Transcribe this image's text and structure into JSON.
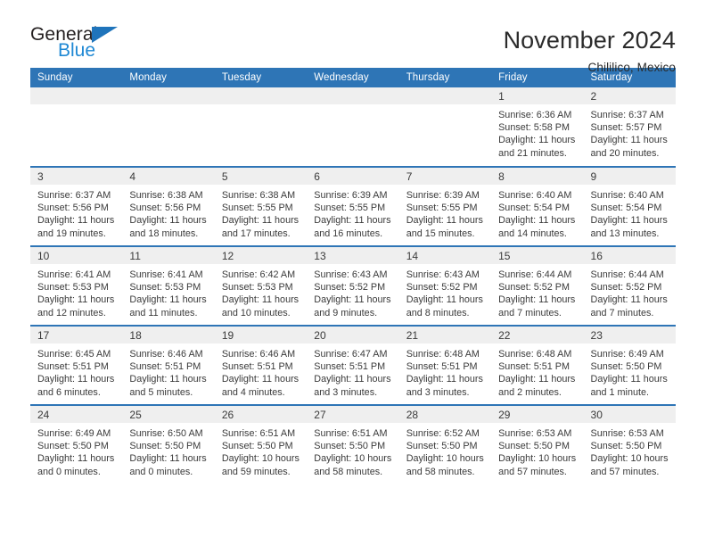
{
  "brand": {
    "name_top": "General",
    "name_bottom": "Blue",
    "triangle_color": "#1f74bb",
    "blue_text_color": "#1f88d4"
  },
  "header": {
    "title": "November 2024",
    "subtitle": "Chililico, Mexico"
  },
  "theme": {
    "header_blue": "#2e75b6",
    "daynum_band": "#efefef",
    "text": "#3a3a3a"
  },
  "weekday_headers": [
    "Sunday",
    "Monday",
    "Tuesday",
    "Wednesday",
    "Thursday",
    "Friday",
    "Saturday"
  ],
  "weeks": [
    [
      {
        "day": "",
        "empty": true
      },
      {
        "day": "",
        "empty": true
      },
      {
        "day": "",
        "empty": true
      },
      {
        "day": "",
        "empty": true
      },
      {
        "day": "",
        "empty": true
      },
      {
        "day": "1",
        "sunrise": "Sunrise: 6:36 AM",
        "sunset": "Sunset: 5:58 PM",
        "daylight1": "Daylight: 11 hours",
        "daylight2": "and 21 minutes."
      },
      {
        "day": "2",
        "sunrise": "Sunrise: 6:37 AM",
        "sunset": "Sunset: 5:57 PM",
        "daylight1": "Daylight: 11 hours",
        "daylight2": "and 20 minutes."
      }
    ],
    [
      {
        "day": "3",
        "sunrise": "Sunrise: 6:37 AM",
        "sunset": "Sunset: 5:56 PM",
        "daylight1": "Daylight: 11 hours",
        "daylight2": "and 19 minutes."
      },
      {
        "day": "4",
        "sunrise": "Sunrise: 6:38 AM",
        "sunset": "Sunset: 5:56 PM",
        "daylight1": "Daylight: 11 hours",
        "daylight2": "and 18 minutes."
      },
      {
        "day": "5",
        "sunrise": "Sunrise: 6:38 AM",
        "sunset": "Sunset: 5:55 PM",
        "daylight1": "Daylight: 11 hours",
        "daylight2": "and 17 minutes."
      },
      {
        "day": "6",
        "sunrise": "Sunrise: 6:39 AM",
        "sunset": "Sunset: 5:55 PM",
        "daylight1": "Daylight: 11 hours",
        "daylight2": "and 16 minutes."
      },
      {
        "day": "7",
        "sunrise": "Sunrise: 6:39 AM",
        "sunset": "Sunset: 5:55 PM",
        "daylight1": "Daylight: 11 hours",
        "daylight2": "and 15 minutes."
      },
      {
        "day": "8",
        "sunrise": "Sunrise: 6:40 AM",
        "sunset": "Sunset: 5:54 PM",
        "daylight1": "Daylight: 11 hours",
        "daylight2": "and 14 minutes."
      },
      {
        "day": "9",
        "sunrise": "Sunrise: 6:40 AM",
        "sunset": "Sunset: 5:54 PM",
        "daylight1": "Daylight: 11 hours",
        "daylight2": "and 13 minutes."
      }
    ],
    [
      {
        "day": "10",
        "sunrise": "Sunrise: 6:41 AM",
        "sunset": "Sunset: 5:53 PM",
        "daylight1": "Daylight: 11 hours",
        "daylight2": "and 12 minutes."
      },
      {
        "day": "11",
        "sunrise": "Sunrise: 6:41 AM",
        "sunset": "Sunset: 5:53 PM",
        "daylight1": "Daylight: 11 hours",
        "daylight2": "and 11 minutes."
      },
      {
        "day": "12",
        "sunrise": "Sunrise: 6:42 AM",
        "sunset": "Sunset: 5:53 PM",
        "daylight1": "Daylight: 11 hours",
        "daylight2": "and 10 minutes."
      },
      {
        "day": "13",
        "sunrise": "Sunrise: 6:43 AM",
        "sunset": "Sunset: 5:52 PM",
        "daylight1": "Daylight: 11 hours",
        "daylight2": "and 9 minutes."
      },
      {
        "day": "14",
        "sunrise": "Sunrise: 6:43 AM",
        "sunset": "Sunset: 5:52 PM",
        "daylight1": "Daylight: 11 hours",
        "daylight2": "and 8 minutes."
      },
      {
        "day": "15",
        "sunrise": "Sunrise: 6:44 AM",
        "sunset": "Sunset: 5:52 PM",
        "daylight1": "Daylight: 11 hours",
        "daylight2": "and 7 minutes."
      },
      {
        "day": "16",
        "sunrise": "Sunrise: 6:44 AM",
        "sunset": "Sunset: 5:52 PM",
        "daylight1": "Daylight: 11 hours",
        "daylight2": "and 7 minutes."
      }
    ],
    [
      {
        "day": "17",
        "sunrise": "Sunrise: 6:45 AM",
        "sunset": "Sunset: 5:51 PM",
        "daylight1": "Daylight: 11 hours",
        "daylight2": "and 6 minutes."
      },
      {
        "day": "18",
        "sunrise": "Sunrise: 6:46 AM",
        "sunset": "Sunset: 5:51 PM",
        "daylight1": "Daylight: 11 hours",
        "daylight2": "and 5 minutes."
      },
      {
        "day": "19",
        "sunrise": "Sunrise: 6:46 AM",
        "sunset": "Sunset: 5:51 PM",
        "daylight1": "Daylight: 11 hours",
        "daylight2": "and 4 minutes."
      },
      {
        "day": "20",
        "sunrise": "Sunrise: 6:47 AM",
        "sunset": "Sunset: 5:51 PM",
        "daylight1": "Daylight: 11 hours",
        "daylight2": "and 3 minutes."
      },
      {
        "day": "21",
        "sunrise": "Sunrise: 6:48 AM",
        "sunset": "Sunset: 5:51 PM",
        "daylight1": "Daylight: 11 hours",
        "daylight2": "and 3 minutes."
      },
      {
        "day": "22",
        "sunrise": "Sunrise: 6:48 AM",
        "sunset": "Sunset: 5:51 PM",
        "daylight1": "Daylight: 11 hours",
        "daylight2": "and 2 minutes."
      },
      {
        "day": "23",
        "sunrise": "Sunrise: 6:49 AM",
        "sunset": "Sunset: 5:50 PM",
        "daylight1": "Daylight: 11 hours",
        "daylight2": "and 1 minute."
      }
    ],
    [
      {
        "day": "24",
        "sunrise": "Sunrise: 6:49 AM",
        "sunset": "Sunset: 5:50 PM",
        "daylight1": "Daylight: 11 hours",
        "daylight2": "and 0 minutes."
      },
      {
        "day": "25",
        "sunrise": "Sunrise: 6:50 AM",
        "sunset": "Sunset: 5:50 PM",
        "daylight1": "Daylight: 11 hours",
        "daylight2": "and 0 minutes."
      },
      {
        "day": "26",
        "sunrise": "Sunrise: 6:51 AM",
        "sunset": "Sunset: 5:50 PM",
        "daylight1": "Daylight: 10 hours",
        "daylight2": "and 59 minutes."
      },
      {
        "day": "27",
        "sunrise": "Sunrise: 6:51 AM",
        "sunset": "Sunset: 5:50 PM",
        "daylight1": "Daylight: 10 hours",
        "daylight2": "and 58 minutes."
      },
      {
        "day": "28",
        "sunrise": "Sunrise: 6:52 AM",
        "sunset": "Sunset: 5:50 PM",
        "daylight1": "Daylight: 10 hours",
        "daylight2": "and 58 minutes."
      },
      {
        "day": "29",
        "sunrise": "Sunrise: 6:53 AM",
        "sunset": "Sunset: 5:50 PM",
        "daylight1": "Daylight: 10 hours",
        "daylight2": "and 57 minutes."
      },
      {
        "day": "30",
        "sunrise": "Sunrise: 6:53 AM",
        "sunset": "Sunset: 5:50 PM",
        "daylight1": "Daylight: 10 hours",
        "daylight2": "and 57 minutes."
      }
    ]
  ]
}
